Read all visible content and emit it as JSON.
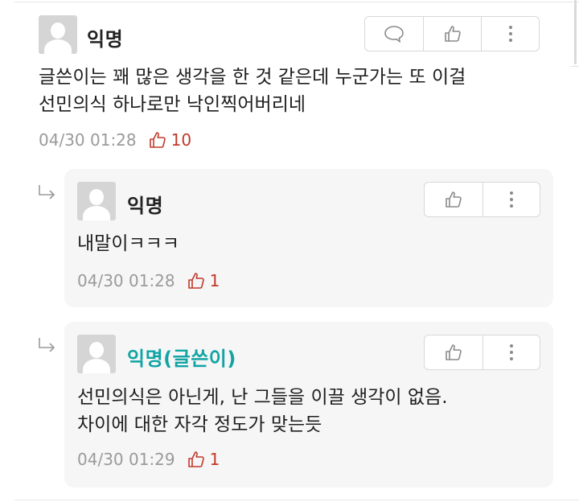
{
  "comments": [
    {
      "author": "익명",
      "text": "글쓴이는 꽤 많은 생각을 한 것 같은데 누군가는 또 이걸\n선민의식 하나로만 낙인찍어버리네",
      "timestamp": "04/30 01:28",
      "likes": "10"
    }
  ],
  "replies": [
    {
      "author": "익명",
      "text": "내말이ㅋㅋㅋ",
      "timestamp": "04/30 01:28",
      "likes": "1"
    },
    {
      "author": "익명(글쓴이)",
      "text": "선민의식은 아닌게, 난 그들을 이끌 생각이 없음.\n차이에 대한 자각 정도가 맞는듯",
      "timestamp": "04/30 01:29",
      "likes": "1"
    }
  ],
  "icons": {
    "reply": "speech-bubble-icon",
    "like": "thumbs-up-icon",
    "more": "more-vertical-icon",
    "reply_marker": "reply-arrow-icon"
  },
  "colors": {
    "op_author": "#12a4a4",
    "like_count": "#c0392b",
    "meta_text": "#9a9a9a",
    "reply_background": "#f6f6f6"
  }
}
